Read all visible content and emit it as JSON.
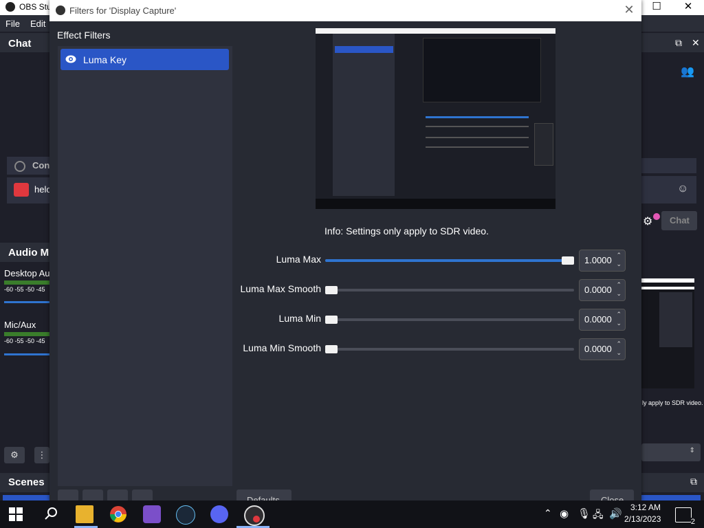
{
  "background_window": {
    "title": "OBS Stu",
    "menu": [
      "File",
      "Edit"
    ],
    "chat_dock_title": "Chat",
    "chat_items": [
      "Con",
      "helo"
    ],
    "audio_mixer_title": "Audio Mi",
    "desktop_audio_label": "Desktop Au",
    "mic_label": "Mic/Aux",
    "meter_ticks": "-60 -55 -50 -45",
    "scenes_title": "Scenes",
    "chat_button_label": "Chat",
    "sdr_note_partial": "ly apply to SDR video."
  },
  "dialog": {
    "title": "Filters for 'Display Capture'",
    "effect_filters_label": "Effect Filters",
    "filters": [
      {
        "label": "Luma Key",
        "selected": true
      }
    ],
    "info": "Info: Settings only apply to SDR video.",
    "settings": [
      {
        "label": "Luma Max",
        "value": "1.0000",
        "fraction": 1.0
      },
      {
        "label": "Luma Max Smooth",
        "value": "0.0000",
        "fraction": 0.0
      },
      {
        "label": "Luma Min",
        "value": "0.0000",
        "fraction": 0.0
      },
      {
        "label": "Luma Min Smooth",
        "value": "0.0000",
        "fraction": 0.0
      }
    ],
    "defaults_button": "Defaults",
    "close_button": "Close"
  },
  "taskbar": {
    "time": "3:12 AM",
    "date": "2/13/2023",
    "notification_count": "2"
  },
  "colors": {
    "accent": "#2a56c6",
    "slider_fill": "#2f74d0",
    "panel_bg": "#272a33"
  }
}
